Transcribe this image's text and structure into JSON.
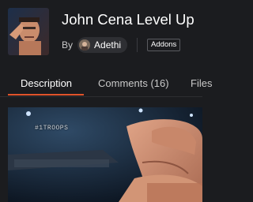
{
  "mod": {
    "title": "John Cena Level Up",
    "by_label": "By",
    "author": "Adethi",
    "category": "Addons"
  },
  "tabs": [
    {
      "label": "Description",
      "active": true
    },
    {
      "label": "Comments (16)",
      "active": false
    },
    {
      "label": "Files",
      "active": false
    }
  ],
  "media": {
    "watermark": "#1TROOPS"
  },
  "colors": {
    "background": "#1b1c1f",
    "accent": "#e0532a",
    "chip": "#2e2f33"
  }
}
